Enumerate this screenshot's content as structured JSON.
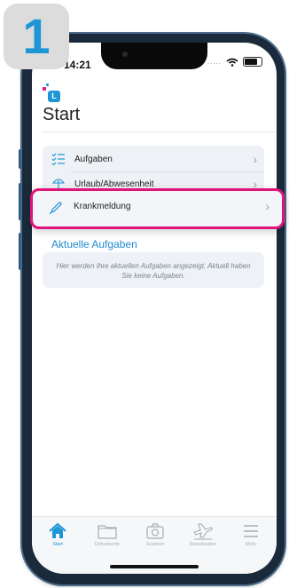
{
  "step_badge": "1",
  "status_bar": {
    "time": "14:21",
    "signal_dots": "....."
  },
  "app": {
    "logo_letter": "L",
    "title": "Start"
  },
  "menu": [
    {
      "label": "Aufgaben",
      "icon": "list-check-icon"
    },
    {
      "label": "Urlaub/Abwesenheit",
      "icon": "beach-umbrella-icon"
    },
    {
      "label": "Krankmeldung",
      "icon": "thermometer-icon"
    }
  ],
  "tasks": {
    "heading": "Aktuelle Aufgaben",
    "empty_message": "Hier werden Ihre aktuellen Aufgaben angezeigt. Aktuell haben Sie keine Aufgaben."
  },
  "tabs": [
    {
      "label": "Start",
      "icon": "home-icon",
      "active": true
    },
    {
      "label": "Dokumente",
      "icon": "folder-icon",
      "active": false
    },
    {
      "label": "Scanner",
      "icon": "camera-icon",
      "active": false
    },
    {
      "label": "Reisekosten",
      "icon": "airplane-icon",
      "active": false
    },
    {
      "label": "Mehr",
      "icon": "menu-lines-icon",
      "active": false
    }
  ],
  "colors": {
    "accent": "#1e96d6",
    "highlight": "#e0147a",
    "card": "#eef1f5"
  }
}
